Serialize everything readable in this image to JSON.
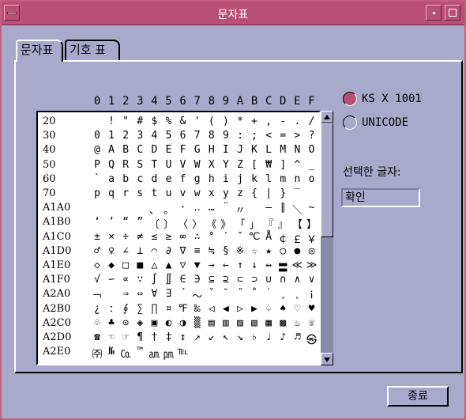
{
  "window": {
    "title": "문자표"
  },
  "tabs": [
    {
      "label": "문자표"
    },
    {
      "label": "기호 표"
    }
  ],
  "grid": {
    "columns": [
      "0",
      "1",
      "2",
      "3",
      "4",
      "5",
      "6",
      "7",
      "8",
      "9",
      "A",
      "B",
      "C",
      "D",
      "E",
      "F"
    ],
    "rows": [
      {
        "label": "20",
        "cells": [
          "",
          "!",
          "\"",
          "#",
          "$",
          "%",
          "&",
          "'",
          "(",
          ")",
          "*",
          "+",
          ",",
          "-",
          ".",
          "/"
        ]
      },
      {
        "label": "30",
        "cells": [
          "0",
          "1",
          "2",
          "3",
          "4",
          "5",
          "6",
          "7",
          "8",
          "9",
          ":",
          ";",
          "<",
          "=",
          ">",
          "?"
        ]
      },
      {
        "label": "40",
        "cells": [
          "@",
          "A",
          "B",
          "C",
          "D",
          "E",
          "F",
          "G",
          "H",
          "I",
          "J",
          "K",
          "L",
          "M",
          "N",
          "O"
        ]
      },
      {
        "label": "50",
        "cells": [
          "P",
          "Q",
          "R",
          "S",
          "T",
          "U",
          "V",
          "W",
          "X",
          "Y",
          "Z",
          "[",
          "₩",
          "]",
          "^",
          "_"
        ]
      },
      {
        "label": "60",
        "cells": [
          "`",
          "a",
          "b",
          "c",
          "d",
          "e",
          "f",
          "g",
          "h",
          "i",
          "j",
          "k",
          "l",
          "m",
          "n",
          "o"
        ]
      },
      {
        "label": "70",
        "cells": [
          "p",
          "q",
          "r",
          "s",
          "t",
          "u",
          "v",
          "w",
          "x",
          "y",
          "z",
          "{",
          "|",
          "}",
          "‾",
          ""
        ]
      },
      {
        "label": "A1A0",
        "cells": [
          "",
          "",
          "",
          "",
          "、",
          "。",
          "·",
          "‥",
          "…",
          "¨",
          "〃",
          "­",
          "―",
          "∥",
          "＼",
          "∼"
        ]
      },
      {
        "label": "A1B0",
        "cells": [
          "‘",
          "’",
          "“",
          "”",
          "〔",
          "〕",
          "〈",
          "〉",
          "《",
          "》",
          "「",
          "」",
          "『",
          "』",
          "【",
          "】"
        ]
      },
      {
        "label": "A1C0",
        "cells": [
          "±",
          "×",
          "÷",
          "≠",
          "≤",
          "≥",
          "∞",
          "∴",
          "°",
          "′",
          "″",
          "℃",
          "Å",
          "￠",
          "￡",
          "￥"
        ]
      },
      {
        "label": "A1D0",
        "cells": [
          "♂",
          "♀",
          "∠",
          "⊥",
          "⌒",
          "∂",
          "∇",
          "≡",
          "≒",
          "§",
          "※",
          "☆",
          "★",
          "○",
          "●",
          "◎"
        ]
      },
      {
        "label": "A1E0",
        "cells": [
          "◇",
          "◆",
          "□",
          "■",
          "△",
          "▲",
          "▽",
          "▼",
          "→",
          "←",
          "↑",
          "↓",
          "↔",
          "〓",
          "≪",
          "≫"
        ]
      },
      {
        "label": "A1F0",
        "cells": [
          "√",
          "∽",
          "∝",
          "∵",
          "∫",
          "∬",
          "∈",
          "∋",
          "⊆",
          "⊇",
          "⊂",
          "⊃",
          "∪",
          "∩",
          "∧",
          "∨"
        ]
      },
      {
        "label": "A2A0",
        "cells": [
          "￢",
          "",
          "⇒",
          "⇔",
          "∀",
          "∃",
          "´",
          "～",
          "ˇ",
          "˘",
          "˝",
          "˚",
          "˙",
          "¸",
          "˛",
          "¡"
        ]
      },
      {
        "label": "A2B0",
        "cells": [
          "¿",
          "ː",
          "∮",
          "∑",
          "∏",
          "¤",
          "℉",
          "‰",
          "◁",
          "◀",
          "▷",
          "▶",
          "♤",
          "♠",
          "♡",
          "♥"
        ]
      },
      {
        "label": "A2C0",
        "cells": [
          "♧",
          "♣",
          "⊙",
          "◈",
          "▣",
          "◐",
          "◑",
          "▒",
          "▤",
          "▥",
          "▨",
          "▧",
          "▦",
          "▩",
          "♨",
          "☏"
        ]
      },
      {
        "label": "A2D0",
        "cells": [
          "☎",
          "☜",
          "☞",
          "¶",
          "†",
          "‡",
          "↕",
          "↗",
          "↙",
          "↖",
          "↘",
          "♭",
          "♩",
          "♪",
          "♬",
          "㉿"
        ]
      },
      {
        "label": "A2E0",
        "cells": [
          "㈜",
          "№",
          "㏇",
          "™",
          "㏂",
          "㏘",
          "℡",
          "",
          "",
          "",
          "",
          "",
          "",
          "",
          "",
          ""
        ]
      }
    ]
  },
  "encoding": {
    "options": [
      {
        "label": "KS X 1001",
        "selected": true
      },
      {
        "label": "UNICODE",
        "selected": false
      }
    ]
  },
  "selection": {
    "label": "선택한 글자:",
    "value": "확인"
  },
  "footer": {
    "close_label": "종료"
  },
  "colors": {
    "titlebar": "#b84f74",
    "background": "#a9a9cb",
    "accent": "#b84f74"
  }
}
